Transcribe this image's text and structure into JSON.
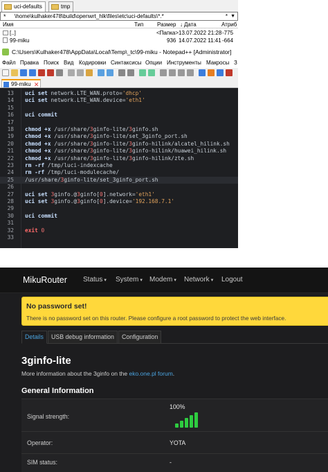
{
  "file_manager": {
    "tabs": [
      "uci-defaults",
      "tmp"
    ],
    "path": "\\home\\kulhaker478\\build\\openwrt_hlk\\files\\etc\\uci-defaults\\*.*",
    "path_star": "*",
    "columns": {
      "name": "Имя",
      "type": "Тип",
      "size": "Размер",
      "date": "Дата",
      "attr": "Атриб"
    },
    "rows": [
      {
        "name": "[..]",
        "type": "",
        "size": "<Папка>",
        "date": "13.07.2022 21:28",
        "attr": "-775"
      },
      {
        "name": "99-miku",
        "type": "",
        "size": "936",
        "date": "14.07.2022 11:41",
        "attr": "-664"
      }
    ]
  },
  "notepad": {
    "title": "C:\\Users\\Kulhaker478\\AppData\\Local\\Temp\\_tc\\99-miku - Notepad++ [Administrator]",
    "menu": [
      "Файл",
      "Правка",
      "Поиск",
      "Вид",
      "Кодировки",
      "Синтаксисы",
      "Опции",
      "Инструменты",
      "Макросы",
      "З"
    ],
    "tab": "99-miku",
    "highlight_line": "25",
    "lines": [
      {
        "n": "13",
        "code": "uci set network.LTE_WAN.proto='dhcp'"
      },
      {
        "n": "14",
        "code": "uci set network.LTE_WAN.device='eth1'"
      },
      {
        "n": "15",
        "code": ""
      },
      {
        "n": "16",
        "code": "uci commit"
      },
      {
        "n": "17",
        "code": ""
      },
      {
        "n": "18",
        "code": "chmod +x /usr/share/3ginfo-lite/3ginfo.sh"
      },
      {
        "n": "19",
        "code": "chmod +x /usr/share/3ginfo-lite/set_3ginfo_port.sh"
      },
      {
        "n": "20",
        "code": "chmod +x /usr/share/3ginfo-lite/3ginfo-hilink/alcatel_hilink.sh"
      },
      {
        "n": "21",
        "code": "chmod +x /usr/share/3ginfo-lite/3ginfo-hilink/huawei_hilink.sh"
      },
      {
        "n": "22",
        "code": "chmod +x /usr/share/3ginfo-lite/3ginfo-hilink/zte.sh"
      },
      {
        "n": "23",
        "code": "rm -rf /tmp/luci-indexcache"
      },
      {
        "n": "24",
        "code": "rm -rf /tmp/luci-modulecache/"
      },
      {
        "n": "25",
        "code": "/usr/share/3ginfo-lite/set_3ginfo_port.sh"
      },
      {
        "n": "26",
        "code": ""
      },
      {
        "n": "27",
        "code": "uci set 3ginfo.@3ginfo[0].network='eth1'"
      },
      {
        "n": "28",
        "code": "uci set 3ginfo.@3ginfo[0].device='192.168.7.1'"
      },
      {
        "n": "29",
        "code": ""
      },
      {
        "n": "30",
        "code": "uci commit"
      },
      {
        "n": "31",
        "code": ""
      },
      {
        "n": "32",
        "code": "exit 0"
      },
      {
        "n": "33",
        "code": ""
      }
    ]
  },
  "router": {
    "brand": "MikuRouter",
    "nav": [
      "Status",
      "System",
      "Modem",
      "Network",
      "Logout"
    ],
    "alert": {
      "title": "No password set!",
      "body": "There is no password set on this router. Please configure a root password to protect the web interface."
    },
    "tabs": [
      "Details",
      "USB debug information",
      "Configuration"
    ],
    "page_title": "3ginfo-lite",
    "description_prefix": "More information about the 3ginfo on the ",
    "description_link": "eko.one.pl forum",
    "description_suffix": ".",
    "section_title": "General Information",
    "rows": [
      {
        "label": "Signal strength:",
        "value": "100%",
        "signal_level": 1.0
      },
      {
        "label": "Operator:",
        "value": "YOTA"
      },
      {
        "label": "SIM status:",
        "value": "-"
      }
    ],
    "colors": {
      "alert": "#ffd83b",
      "link": "#4aa3df",
      "signal": "#2ecc40"
    }
  }
}
